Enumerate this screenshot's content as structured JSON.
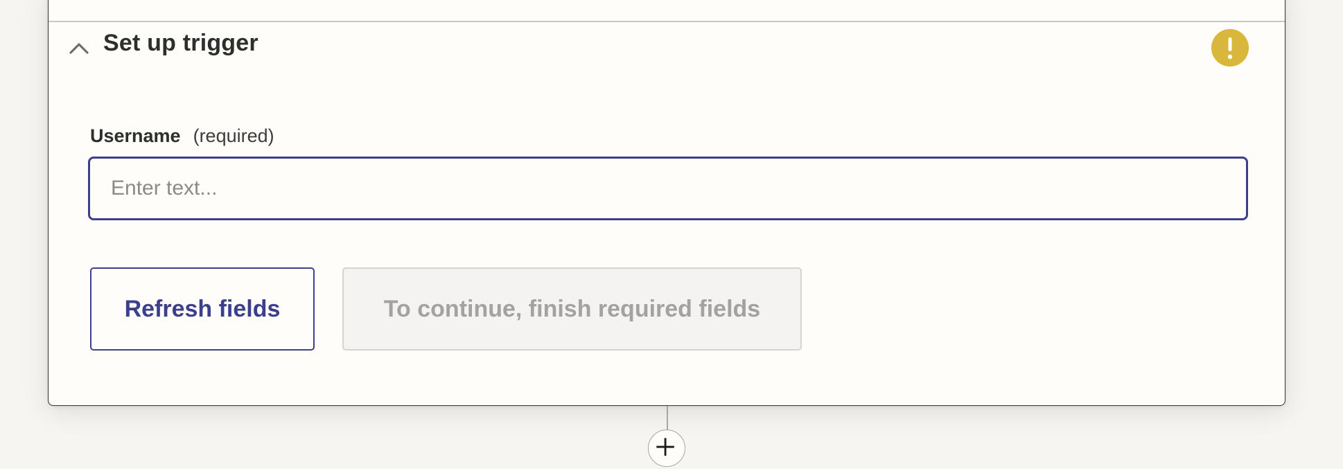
{
  "trigger_section": {
    "title": "Set up trigger",
    "collapse_icon": "chevron-up-icon",
    "status_icon": "exclamation-warning-icon",
    "status_color": "#d9b73a"
  },
  "previous_step": {
    "status_color": "#2c7b4e"
  },
  "username_field": {
    "label": "Username",
    "required_note": "(required)",
    "value": "",
    "placeholder": "Enter text..."
  },
  "actions": {
    "refresh_label": "Refresh fields",
    "continue_label": "To continue, finish required fields"
  },
  "add_step": {
    "icon": "plus-icon"
  },
  "colors": {
    "accent": "#3b3f8c",
    "warning": "#d9b73a",
    "success": "#2c7b4e",
    "disabled_text": "#a4a29e"
  }
}
